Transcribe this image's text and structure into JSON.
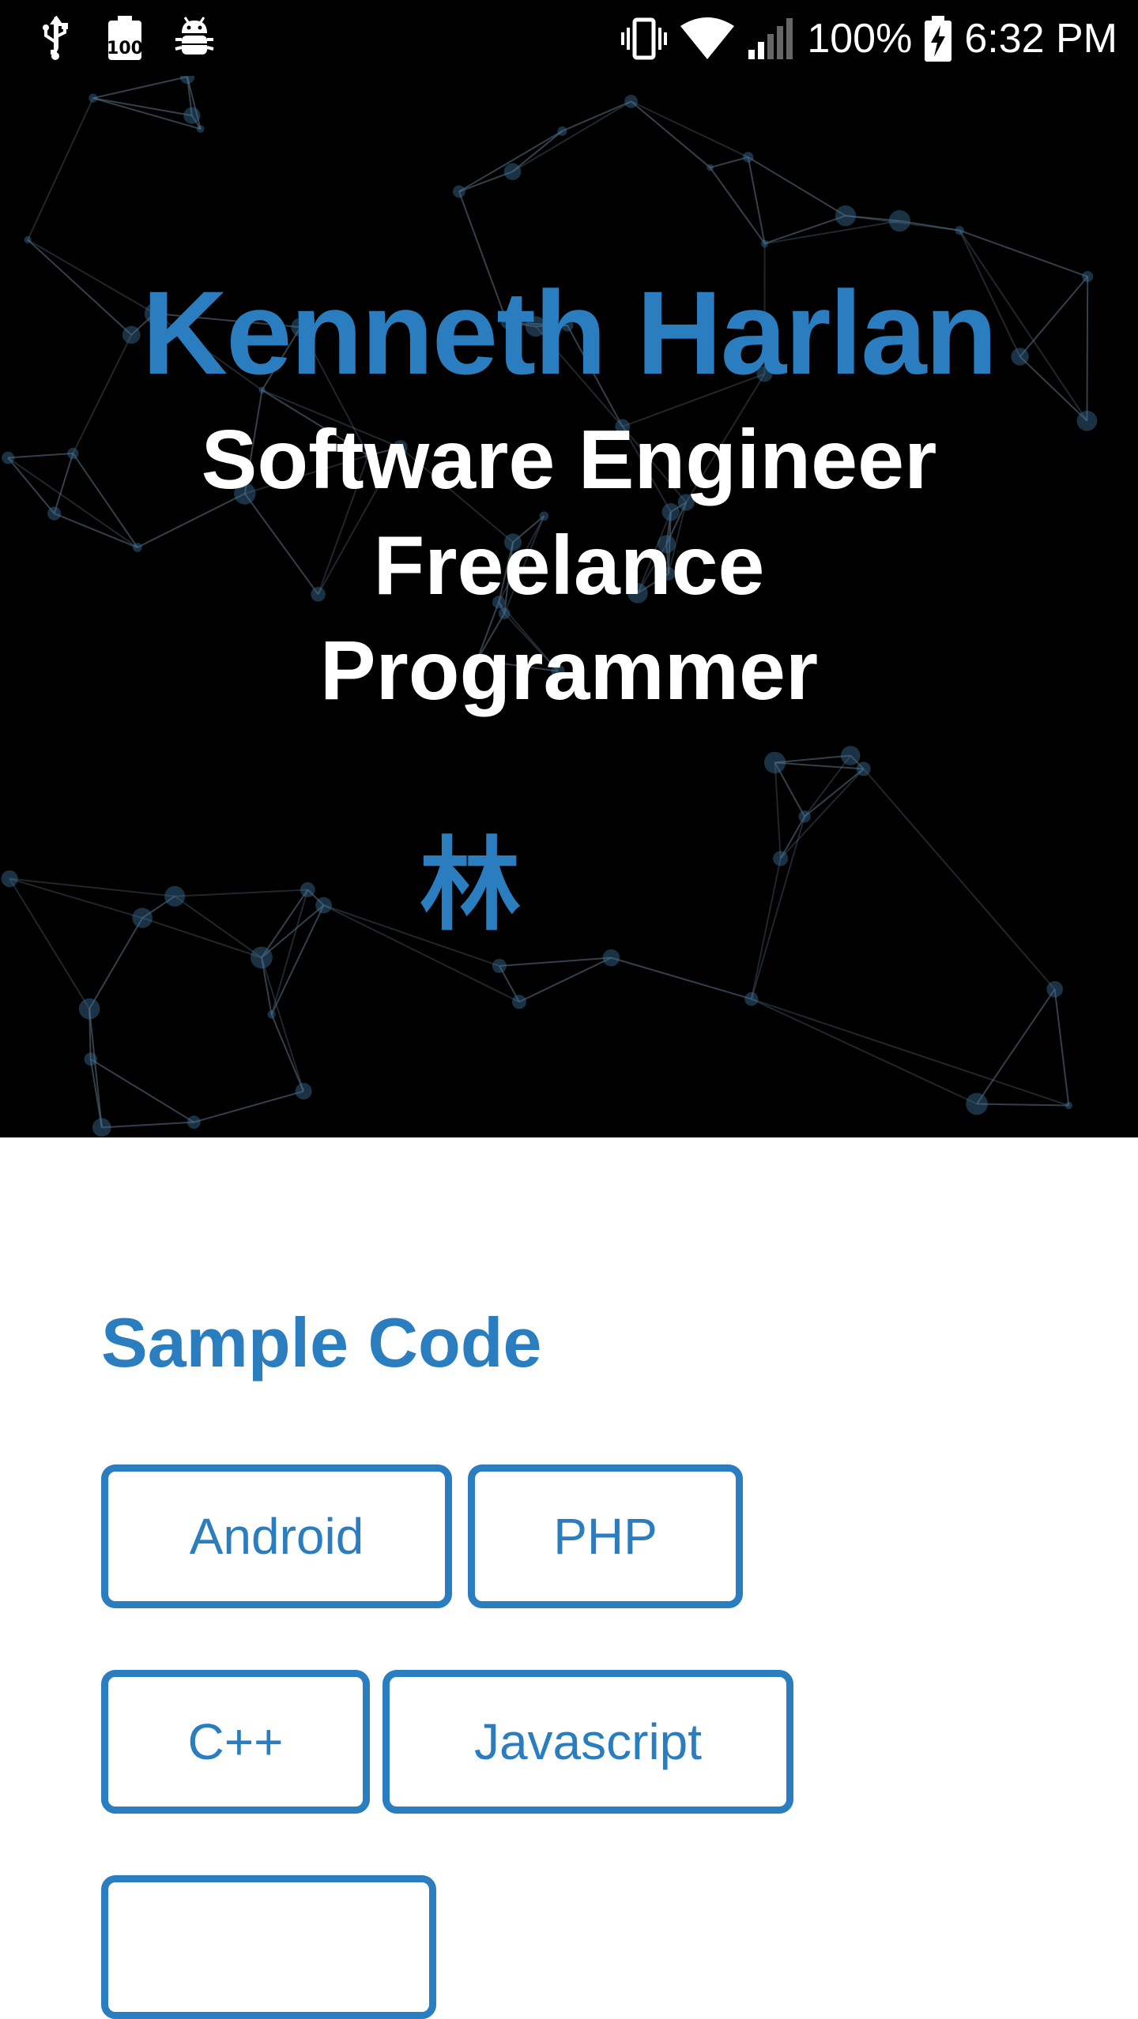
{
  "status_bar": {
    "left_icons": [
      "usb-icon",
      "battery-saver-100-icon",
      "android-debug-icon"
    ],
    "right_icons": [
      "vibrate-icon",
      "wifi-icon",
      "cellular-signal-icon",
      "battery-charging-icon"
    ],
    "battery_percent": "100%",
    "time": "6:32 PM"
  },
  "hero": {
    "name": "Kenneth Harlan",
    "roles": [
      "Software Engineer",
      "Freelance",
      "Programmer"
    ],
    "cjk_name": "林  ",
    "background_icon": "network-constellation-background"
  },
  "sample_code": {
    "title": "Sample Code",
    "buttons": [
      "Android",
      "PHP",
      "C++",
      "Javascript"
    ]
  },
  "colors": {
    "accent": "#2a7dbf",
    "hero_background": "#000000",
    "page_background": "#ffffff",
    "hero_text": "#ffffff"
  }
}
